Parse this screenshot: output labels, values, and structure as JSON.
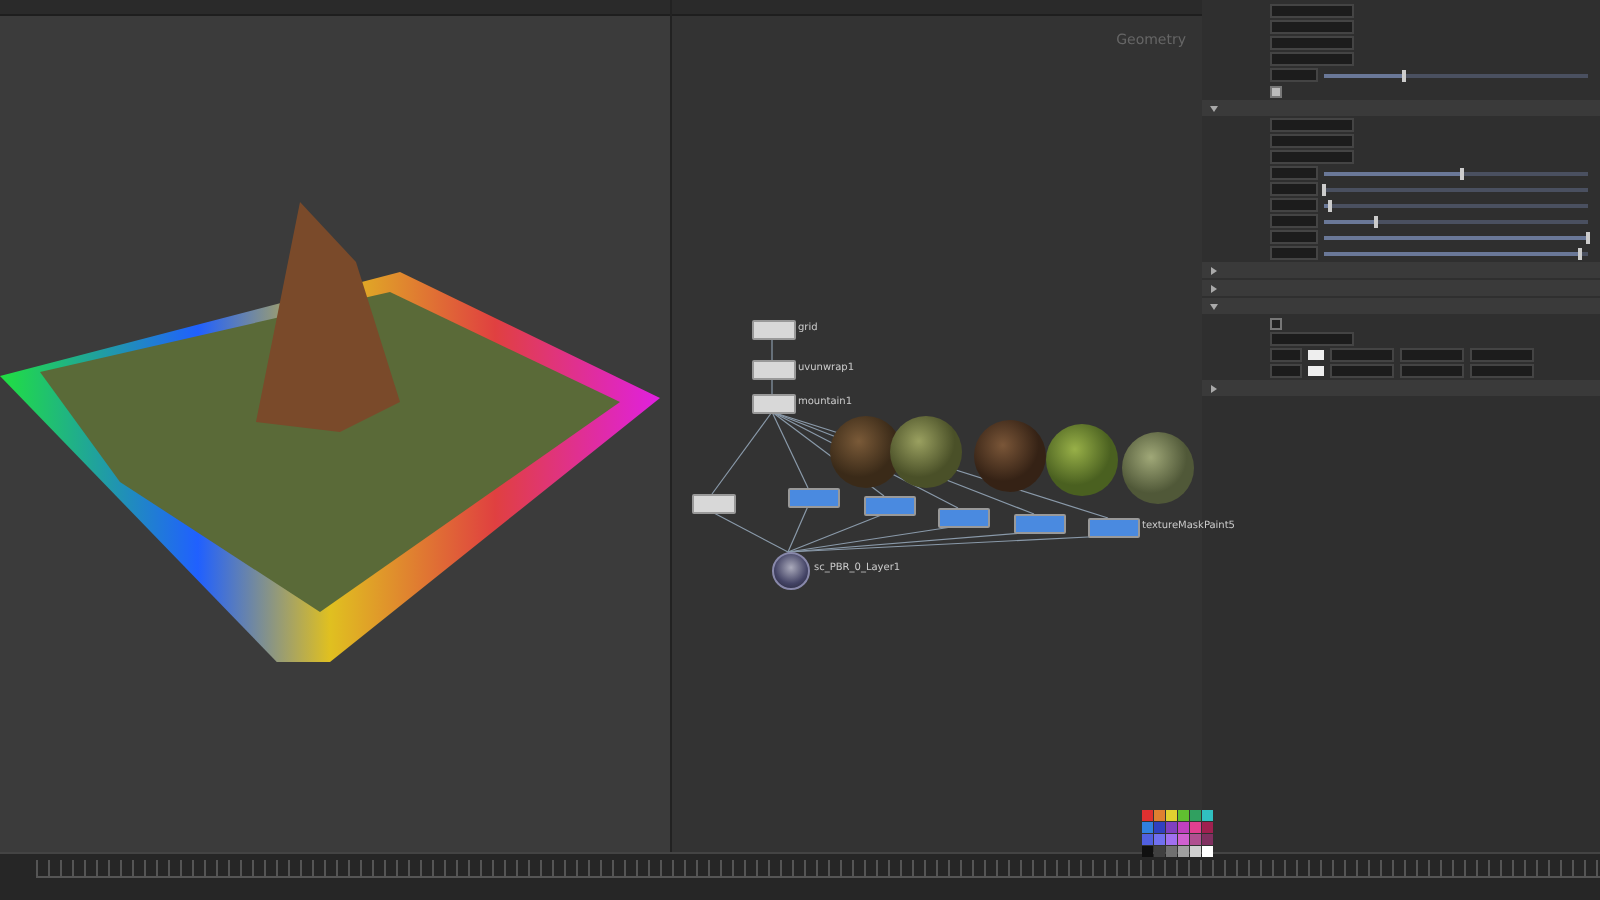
{
  "network": {
    "context": "Geometry"
  },
  "nodes": [
    {
      "kind": "sop",
      "label": "grid"
    },
    {
      "kind": "sop",
      "label": "uvunwrap1"
    },
    {
      "kind": "sop",
      "label": "mountain1"
    },
    {
      "kind": "sop"
    },
    {
      "kind": "texture"
    },
    {
      "kind": "texture"
    },
    {
      "kind": "texture"
    },
    {
      "kind": "texture"
    },
    {
      "kind": "texture",
      "label": "textureMaskPaint5"
    },
    {
      "kind": "shader",
      "label": "sc_PBR_0_Layer1"
    }
  ],
  "params": [
    {
      "kind": "field"
    },
    {
      "kind": "field"
    },
    {
      "kind": "field"
    },
    {
      "kind": "field"
    },
    {
      "kind": "slider",
      "level": 0.3
    },
    {
      "kind": "checkbox",
      "checked": true
    },
    {
      "kind": "section",
      "expanded": true
    },
    {
      "kind": "field"
    },
    {
      "kind": "field"
    },
    {
      "kind": "field"
    },
    {
      "kind": "slider",
      "level": 0.52
    },
    {
      "kind": "slider",
      "level": 0.0
    },
    {
      "kind": "slider",
      "level": 0.02
    },
    {
      "kind": "slider",
      "level": 0.2
    },
    {
      "kind": "slider",
      "level": 1.0
    },
    {
      "kind": "slider",
      "level": 0.97
    },
    {
      "kind": "section",
      "expanded": false
    },
    {
      "kind": "section",
      "expanded": false
    },
    {
      "kind": "section",
      "expanded": true
    },
    {
      "kind": "checkbox",
      "checked": false
    },
    {
      "kind": "field"
    },
    {
      "kind": "color"
    },
    {
      "kind": "color"
    },
    {
      "kind": "section",
      "expanded": false
    }
  ]
}
